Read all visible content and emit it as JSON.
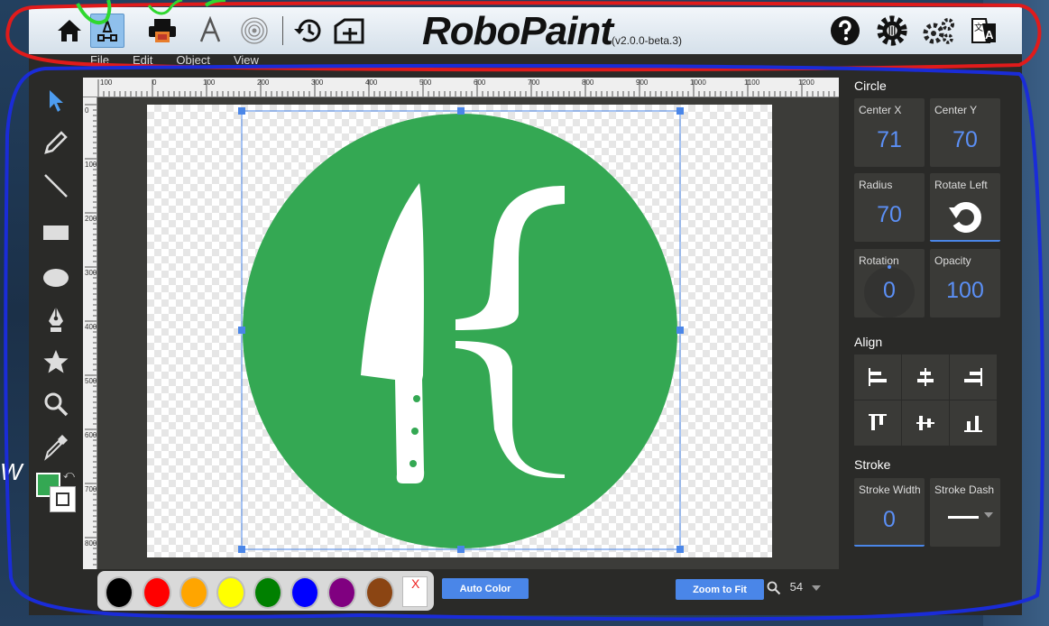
{
  "app": {
    "name": "RoboPaint",
    "version": "(v2.0.0-beta.3)"
  },
  "toolbar": {
    "buttons": [
      "home",
      "draw",
      "print",
      "text",
      "spiral",
      "history",
      "import"
    ],
    "right_buttons": [
      "help",
      "settings",
      "advanced-settings",
      "language"
    ]
  },
  "menu": {
    "items": [
      "File",
      "Edit",
      "Object",
      "View"
    ]
  },
  "tools": [
    "select",
    "pencil",
    "line",
    "rectangle",
    "ellipse",
    "pen",
    "star",
    "zoom",
    "eyedropper"
  ],
  "ruler": {
    "top_labels": [
      "100",
      "0",
      "100",
      "200",
      "300",
      "400",
      "500",
      "600",
      "700",
      "800",
      "900",
      "1000",
      "1100",
      "1200"
    ],
    "left_labels": [
      "0",
      "100",
      "200",
      "300",
      "400",
      "500",
      "600",
      "700",
      "800"
    ]
  },
  "panel": {
    "circle_title": "Circle",
    "center_x_label": "Center X",
    "center_x": "71",
    "center_y_label": "Center Y",
    "center_y": "70",
    "radius_label": "Radius",
    "radius": "70",
    "rotate_left_label": "Rotate Left",
    "rotation_label": "Rotation",
    "rotation": "0",
    "opacity_label": "Opacity",
    "opacity": "100",
    "align_title": "Align",
    "stroke_title": "Stroke",
    "stroke_width_label": "Stroke Width",
    "stroke_width": "0",
    "stroke_dash_label": "Stroke Dash"
  },
  "palette": {
    "colors": [
      "#000000",
      "#ff0000",
      "#ffa500",
      "#ffff00",
      "#008000",
      "#0000ff",
      "#800080",
      "#8b4513"
    ],
    "clear_label": "X"
  },
  "buttons": {
    "auto_color": "Auto Color",
    "zoom_to_fit": "Zoom to Fit"
  },
  "zoom": {
    "level": "54"
  },
  "colors": {
    "fill": "#34a853",
    "accent": "#4a86e8"
  },
  "side_text": "W"
}
